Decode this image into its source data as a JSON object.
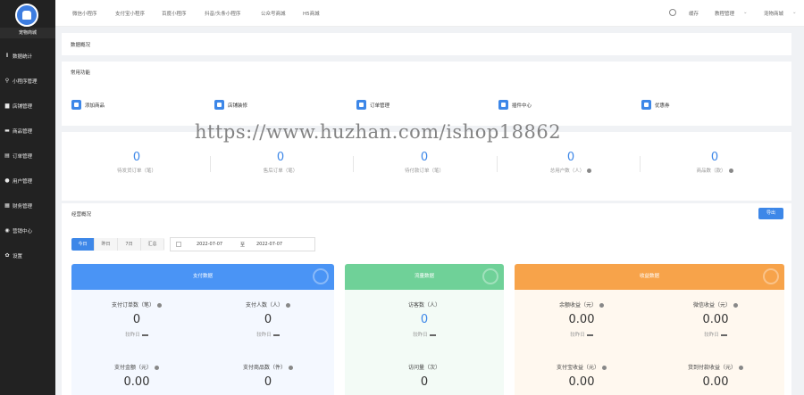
{
  "sidebar": {
    "brand": "宠物商城",
    "items": [
      {
        "label": "数据统计",
        "icon": "chart-icon",
        "glyph": "⫴"
      },
      {
        "label": "小程序管理",
        "icon": "link-icon",
        "glyph": "⚲"
      },
      {
        "label": "店铺管理",
        "icon": "store-icon",
        "glyph": "▆"
      },
      {
        "label": "商品管理",
        "icon": "goods-icon",
        "glyph": "▬"
      },
      {
        "label": "订单管理",
        "icon": "order-icon",
        "glyph": "▤"
      },
      {
        "label": "用户管理",
        "icon": "user-icon",
        "glyph": "●"
      },
      {
        "label": "财务管理",
        "icon": "finance-icon",
        "glyph": "▦"
      },
      {
        "label": "营销中心",
        "icon": "marketing-icon",
        "glyph": "◉"
      },
      {
        "label": "设置",
        "icon": "gear-icon",
        "glyph": "✿"
      }
    ]
  },
  "topbar": {
    "links": [
      "微信小程序",
      "支付宝小程序",
      "百度小程序",
      "抖音/头条小程序",
      "公众号商城",
      "H5商城"
    ],
    "cache": "缓存",
    "account": "教程管理",
    "store": "宠物商城"
  },
  "overview_title": "数据概况",
  "common": {
    "title": "常用功能",
    "items": [
      "添加商品",
      "店铺装修",
      "订单管理",
      "插件中心",
      "优惠券"
    ]
  },
  "stats": [
    {
      "value": "0",
      "label": "待发货订单（笔）"
    },
    {
      "value": "0",
      "label": "售后订单（笔）"
    },
    {
      "value": "0",
      "label": "待付款订单（笔）"
    },
    {
      "value": "0",
      "label": "总用户数（人）"
    },
    {
      "value": "0",
      "label": "商品数（款）"
    }
  ],
  "business": {
    "title": "经营概况",
    "export": "导出",
    "tabs": [
      "今日",
      "昨日",
      "7日",
      "汇总"
    ],
    "date_start": "2022-07-07",
    "date_sep": "至",
    "date_end": "2022-07-07"
  },
  "cards": {
    "pay": {
      "title": "支付数据",
      "cells": [
        {
          "label": "支付订单数（笔）",
          "value": "0",
          "compare": "较昨日"
        },
        {
          "label": "支付人数（人）",
          "value": "0",
          "compare": "较昨日"
        },
        {
          "label": "支付金额（元）",
          "value": "0.00"
        },
        {
          "label": "支付商品数（件）",
          "value": "0"
        }
      ]
    },
    "flow": {
      "title": "流量数据",
      "cells": [
        {
          "label": "访客数（人）",
          "value": "0",
          "compare": "较昨日"
        },
        {
          "label": "访问量（次）",
          "value": "0"
        }
      ]
    },
    "income": {
      "title": "收益数据",
      "cells": [
        {
          "label": "余额收益（元）",
          "value": "0.00",
          "compare": "较昨日"
        },
        {
          "label": "微信收益（元）",
          "value": "0.00",
          "compare": "较昨日"
        },
        {
          "label": "支付宝收益（元）",
          "value": "0.00"
        },
        {
          "label": "货到付款收益（元）",
          "value": "0.00"
        }
      ]
    }
  },
  "watermark": "https://www.huzhan.com/ishop18862",
  "colors": {
    "sidebar": "#222222",
    "accent": "#3d87e8",
    "pay": "#4a94f5",
    "flow": "#6fd198",
    "income": "#f7a34a"
  }
}
